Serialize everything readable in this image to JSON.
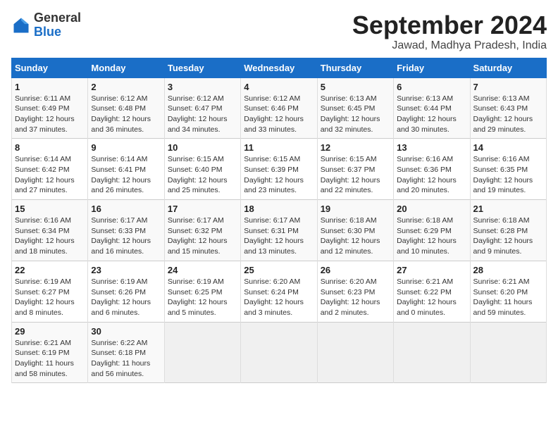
{
  "header": {
    "logo_general": "General",
    "logo_blue": "Blue",
    "month_title": "September 2024",
    "location": "Jawad, Madhya Pradesh, India"
  },
  "weekdays": [
    "Sunday",
    "Monday",
    "Tuesday",
    "Wednesday",
    "Thursday",
    "Friday",
    "Saturday"
  ],
  "weeks": [
    [
      {
        "day": "1",
        "lines": [
          "Sunrise: 6:11 AM",
          "Sunset: 6:49 PM",
          "Daylight: 12 hours",
          "and 37 minutes."
        ]
      },
      {
        "day": "2",
        "lines": [
          "Sunrise: 6:12 AM",
          "Sunset: 6:48 PM",
          "Daylight: 12 hours",
          "and 36 minutes."
        ]
      },
      {
        "day": "3",
        "lines": [
          "Sunrise: 6:12 AM",
          "Sunset: 6:47 PM",
          "Daylight: 12 hours",
          "and 34 minutes."
        ]
      },
      {
        "day": "4",
        "lines": [
          "Sunrise: 6:12 AM",
          "Sunset: 6:46 PM",
          "Daylight: 12 hours",
          "and 33 minutes."
        ]
      },
      {
        "day": "5",
        "lines": [
          "Sunrise: 6:13 AM",
          "Sunset: 6:45 PM",
          "Daylight: 12 hours",
          "and 32 minutes."
        ]
      },
      {
        "day": "6",
        "lines": [
          "Sunrise: 6:13 AM",
          "Sunset: 6:44 PM",
          "Daylight: 12 hours",
          "and 30 minutes."
        ]
      },
      {
        "day": "7",
        "lines": [
          "Sunrise: 6:13 AM",
          "Sunset: 6:43 PM",
          "Daylight: 12 hours",
          "and 29 minutes."
        ]
      }
    ],
    [
      {
        "day": "8",
        "lines": [
          "Sunrise: 6:14 AM",
          "Sunset: 6:42 PM",
          "Daylight: 12 hours",
          "and 27 minutes."
        ]
      },
      {
        "day": "9",
        "lines": [
          "Sunrise: 6:14 AM",
          "Sunset: 6:41 PM",
          "Daylight: 12 hours",
          "and 26 minutes."
        ]
      },
      {
        "day": "10",
        "lines": [
          "Sunrise: 6:15 AM",
          "Sunset: 6:40 PM",
          "Daylight: 12 hours",
          "and 25 minutes."
        ]
      },
      {
        "day": "11",
        "lines": [
          "Sunrise: 6:15 AM",
          "Sunset: 6:39 PM",
          "Daylight: 12 hours",
          "and 23 minutes."
        ]
      },
      {
        "day": "12",
        "lines": [
          "Sunrise: 6:15 AM",
          "Sunset: 6:37 PM",
          "Daylight: 12 hours",
          "and 22 minutes."
        ]
      },
      {
        "day": "13",
        "lines": [
          "Sunrise: 6:16 AM",
          "Sunset: 6:36 PM",
          "Daylight: 12 hours",
          "and 20 minutes."
        ]
      },
      {
        "day": "14",
        "lines": [
          "Sunrise: 6:16 AM",
          "Sunset: 6:35 PM",
          "Daylight: 12 hours",
          "and 19 minutes."
        ]
      }
    ],
    [
      {
        "day": "15",
        "lines": [
          "Sunrise: 6:16 AM",
          "Sunset: 6:34 PM",
          "Daylight: 12 hours",
          "and 18 minutes."
        ]
      },
      {
        "day": "16",
        "lines": [
          "Sunrise: 6:17 AM",
          "Sunset: 6:33 PM",
          "Daylight: 12 hours",
          "and 16 minutes."
        ]
      },
      {
        "day": "17",
        "lines": [
          "Sunrise: 6:17 AM",
          "Sunset: 6:32 PM",
          "Daylight: 12 hours",
          "and 15 minutes."
        ]
      },
      {
        "day": "18",
        "lines": [
          "Sunrise: 6:17 AM",
          "Sunset: 6:31 PM",
          "Daylight: 12 hours",
          "and 13 minutes."
        ]
      },
      {
        "day": "19",
        "lines": [
          "Sunrise: 6:18 AM",
          "Sunset: 6:30 PM",
          "Daylight: 12 hours",
          "and 12 minutes."
        ]
      },
      {
        "day": "20",
        "lines": [
          "Sunrise: 6:18 AM",
          "Sunset: 6:29 PM",
          "Daylight: 12 hours",
          "and 10 minutes."
        ]
      },
      {
        "day": "21",
        "lines": [
          "Sunrise: 6:18 AM",
          "Sunset: 6:28 PM",
          "Daylight: 12 hours",
          "and 9 minutes."
        ]
      }
    ],
    [
      {
        "day": "22",
        "lines": [
          "Sunrise: 6:19 AM",
          "Sunset: 6:27 PM",
          "Daylight: 12 hours",
          "and 8 minutes."
        ]
      },
      {
        "day": "23",
        "lines": [
          "Sunrise: 6:19 AM",
          "Sunset: 6:26 PM",
          "Daylight: 12 hours",
          "and 6 minutes."
        ]
      },
      {
        "day": "24",
        "lines": [
          "Sunrise: 6:19 AM",
          "Sunset: 6:25 PM",
          "Daylight: 12 hours",
          "and 5 minutes."
        ]
      },
      {
        "day": "25",
        "lines": [
          "Sunrise: 6:20 AM",
          "Sunset: 6:24 PM",
          "Daylight: 12 hours",
          "and 3 minutes."
        ]
      },
      {
        "day": "26",
        "lines": [
          "Sunrise: 6:20 AM",
          "Sunset: 6:23 PM",
          "Daylight: 12 hours",
          "and 2 minutes."
        ]
      },
      {
        "day": "27",
        "lines": [
          "Sunrise: 6:21 AM",
          "Sunset: 6:22 PM",
          "Daylight: 12 hours",
          "and 0 minutes."
        ]
      },
      {
        "day": "28",
        "lines": [
          "Sunrise: 6:21 AM",
          "Sunset: 6:20 PM",
          "Daylight: 11 hours",
          "and 59 minutes."
        ]
      }
    ],
    [
      {
        "day": "29",
        "lines": [
          "Sunrise: 6:21 AM",
          "Sunset: 6:19 PM",
          "Daylight: 11 hours",
          "and 58 minutes."
        ]
      },
      {
        "day": "30",
        "lines": [
          "Sunrise: 6:22 AM",
          "Sunset: 6:18 PM",
          "Daylight: 11 hours",
          "and 56 minutes."
        ]
      },
      null,
      null,
      null,
      null,
      null
    ]
  ]
}
